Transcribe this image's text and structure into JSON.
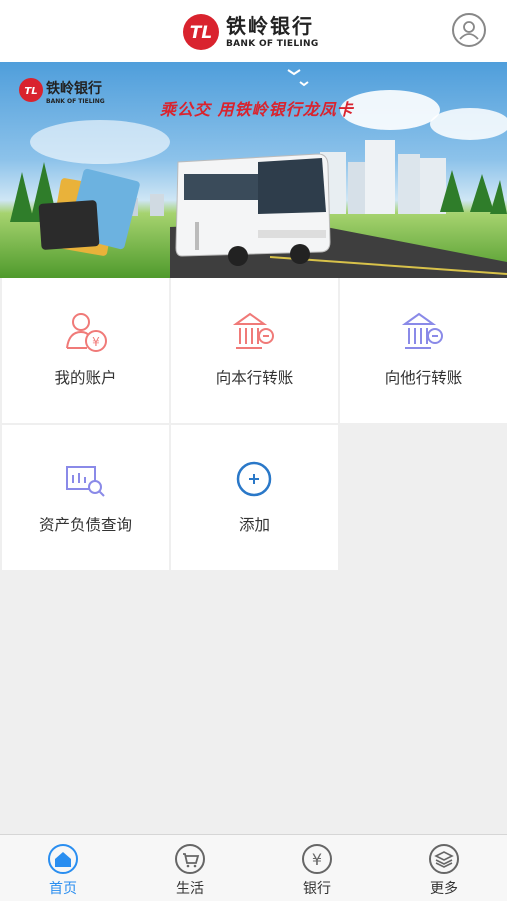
{
  "header": {
    "logo_cn": "铁岭银行",
    "logo_en": "BANK OF TIELING"
  },
  "banner": {
    "logo_cn": "铁岭银行",
    "logo_en": "BANK OF TIELING",
    "slogan": "乘公交  用铁岭银行龙凤卡"
  },
  "menu": {
    "items": [
      {
        "label": "我的账户",
        "icon": "user-yen-icon"
      },
      {
        "label": "向本行转账",
        "icon": "bank-transfer-icon"
      },
      {
        "label": "向他行转账",
        "icon": "other-bank-transfer-icon"
      },
      {
        "label": "资产负债查询",
        "icon": "asset-query-icon"
      },
      {
        "label": "添加",
        "icon": "add-icon"
      }
    ]
  },
  "tabbar": {
    "items": [
      {
        "label": "首页",
        "icon": "home-icon",
        "active": true
      },
      {
        "label": "生活",
        "icon": "cart-icon",
        "active": false
      },
      {
        "label": "银行",
        "icon": "yen-icon",
        "active": false
      },
      {
        "label": "更多",
        "icon": "layers-icon",
        "active": false
      }
    ]
  },
  "colors": {
    "accent": "#2a8ef0",
    "brand_red": "#d9232e",
    "icon_red": "#f07a78",
    "icon_purple": "#8a8ae8"
  }
}
